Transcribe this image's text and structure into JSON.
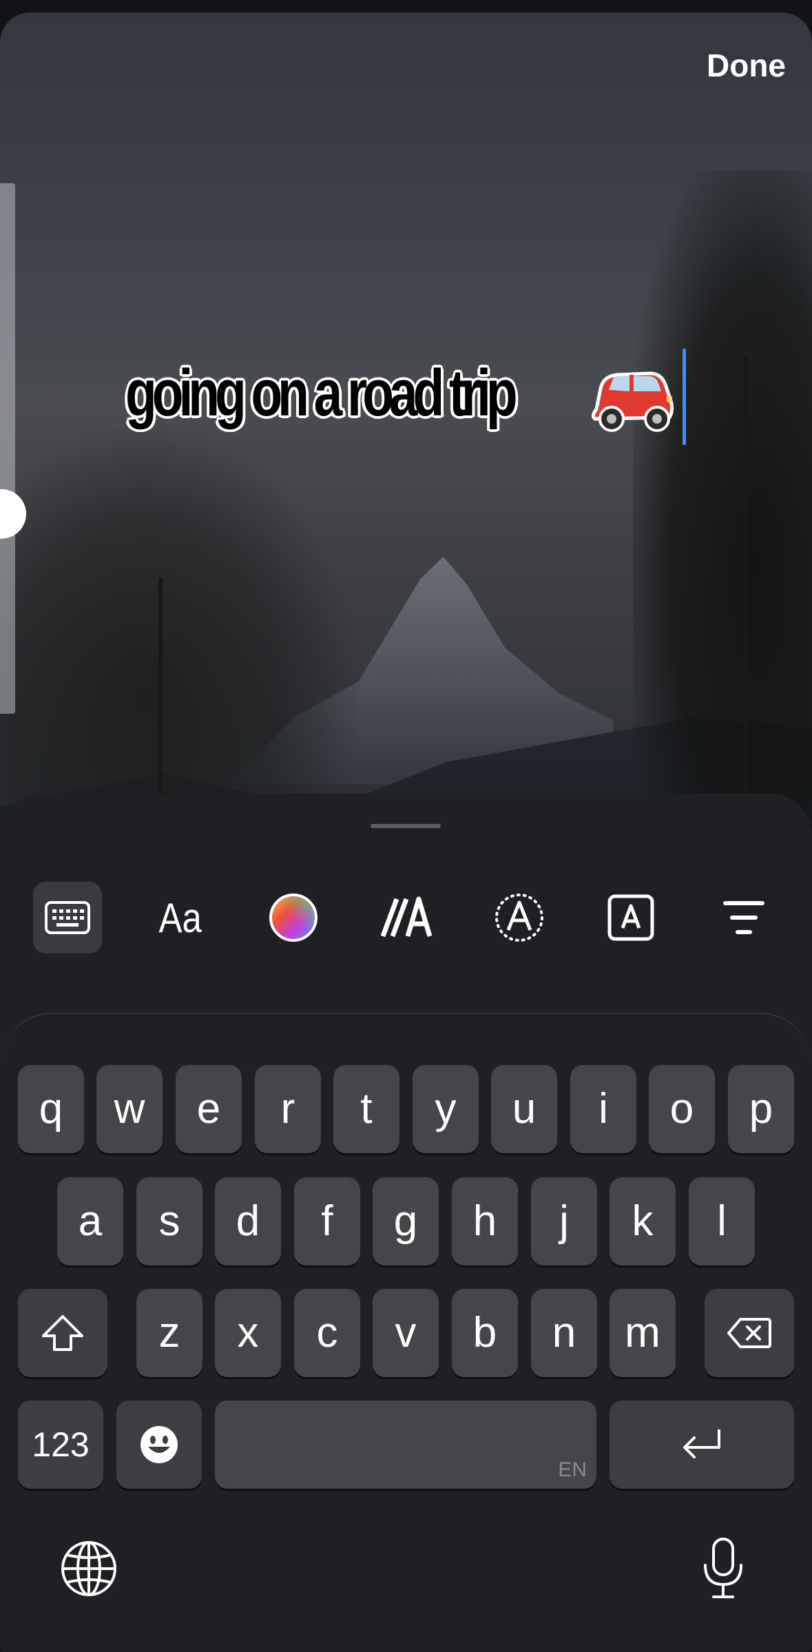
{
  "header": {
    "done_label": "Done"
  },
  "caption": {
    "text": "going on a road trip",
    "emoji": "car-emoji"
  },
  "toolbar": {
    "items": [
      {
        "name": "keyboard",
        "icon": "keyboard-icon",
        "active": true
      },
      {
        "name": "font",
        "label": "Aa"
      },
      {
        "name": "color",
        "icon": "color-wheel-icon"
      },
      {
        "name": "animate",
        "icon": "animate-text-icon"
      },
      {
        "name": "effects",
        "icon": "text-effect-icon"
      },
      {
        "name": "background",
        "icon": "text-background-icon"
      },
      {
        "name": "align",
        "icon": "align-center-icon"
      }
    ]
  },
  "keyboard": {
    "row1": [
      "q",
      "w",
      "e",
      "r",
      "t",
      "y",
      "u",
      "i",
      "o",
      "p"
    ],
    "row2": [
      "a",
      "s",
      "d",
      "f",
      "g",
      "h",
      "j",
      "k",
      "l"
    ],
    "row3": [
      "z",
      "x",
      "c",
      "v",
      "b",
      "n",
      "m"
    ],
    "numbers_label": "123",
    "space_hint": "EN",
    "icons": [
      "shift-icon",
      "backspace-icon",
      "emoji-icon",
      "return-icon",
      "globe-icon",
      "microphone-icon"
    ]
  },
  "colors": {
    "cursor": "#3f8df7",
    "key": "#45464a",
    "sheet": "#1f2024"
  }
}
